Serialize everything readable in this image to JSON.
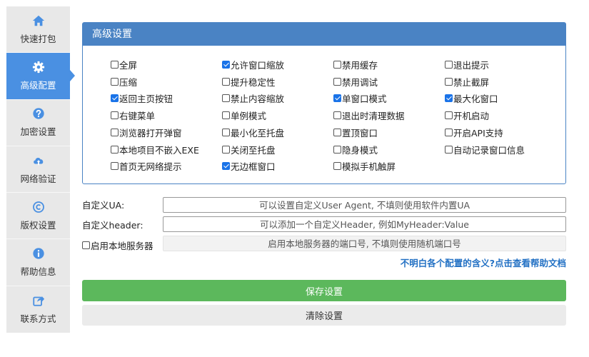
{
  "sidebar": {
    "items": [
      {
        "label": "快速打包",
        "icon": "home-icon",
        "active": false
      },
      {
        "label": "高级配置",
        "icon": "gear-icon",
        "active": true
      },
      {
        "label": "加密设置",
        "icon": "question-icon",
        "active": false
      },
      {
        "label": "网络验证",
        "icon": "cloud-upload-icon",
        "active": false
      },
      {
        "label": "版权设置",
        "icon": "copyright-icon",
        "active": false
      },
      {
        "label": "帮助信息",
        "icon": "info-icon",
        "active": false
      },
      {
        "label": "联系方式",
        "icon": "share-icon",
        "active": false
      }
    ]
  },
  "panel": {
    "title": "高级设置",
    "options": [
      [
        "全屏",
        "允许窗口缩放",
        "禁用缓存",
        "退出提示"
      ],
      [
        "压缩",
        "提升稳定性",
        "禁用调试",
        "禁止截屏"
      ],
      [
        "返回主页按钮",
        "禁止内容缩放",
        "单窗口模式",
        "最大化窗口"
      ],
      [
        "右键菜单",
        "单例模式",
        "退出时清理数据",
        "开机启动"
      ],
      [
        "浏览器打开弹窗",
        "最小化至托盘",
        "置顶窗口",
        "开启API支持"
      ],
      [
        "本地项目不嵌入EXE",
        "关闭至托盘",
        "隐身模式",
        "自动记录窗口信息"
      ],
      [
        "首页无网络提示",
        "无边框窗口",
        "模拟手机触屏"
      ]
    ],
    "checked": [
      [
        false,
        true,
        false,
        false
      ],
      [
        false,
        false,
        false,
        false
      ],
      [
        true,
        false,
        true,
        true
      ],
      [
        false,
        false,
        false,
        false
      ],
      [
        false,
        false,
        false,
        false
      ],
      [
        false,
        false,
        false,
        false
      ],
      [
        false,
        true,
        false
      ]
    ]
  },
  "form": {
    "ua_label": "自定义UA:",
    "ua_placeholder": "可以设置自定义User Agent, 不填则使用软件内置UA",
    "header_label": "自定义header:",
    "header_placeholder": "可以添加一个自定义Header, 例如MyHeader:Value",
    "server_label": "启用本地服务器",
    "server_checked": false,
    "server_placeholder": "启用本地服务器的端口号, 不填则使用随机端口号"
  },
  "help_link": "不明白各个配置的含义?点击查看帮助文档",
  "buttons": {
    "save": "保存设置",
    "clear": "清除设置"
  },
  "colors": {
    "accent": "#4a90e2",
    "panel_header": "#4a83c4",
    "save": "#5cb85c",
    "checkbox_on": "#1a73e8",
    "link": "#2371c4"
  }
}
